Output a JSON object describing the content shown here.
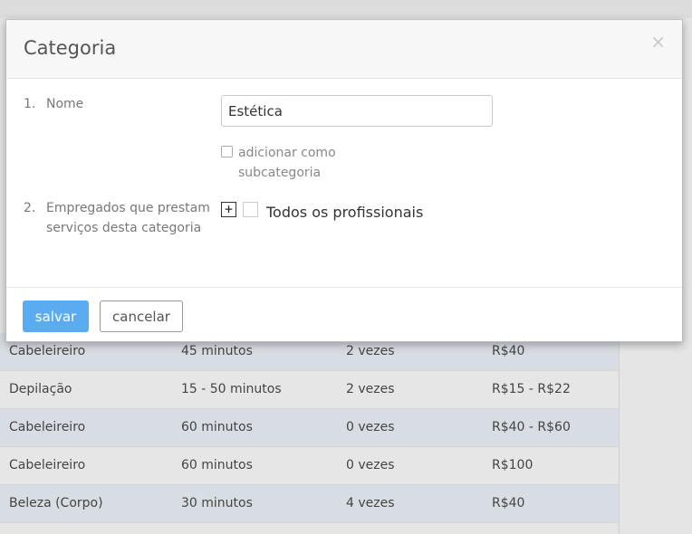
{
  "modal": {
    "title": "Categoria",
    "close_glyph": "×",
    "fields": {
      "name": {
        "number": "1.",
        "label": "Nome",
        "value": "Estética"
      },
      "subcategory": {
        "label": "adicionar como subcategoria",
        "checked": false
      },
      "employees": {
        "number": "2.",
        "label": "Empregados que prestam serviços desta categoria",
        "expand_glyph": "+",
        "all_label": "Todos os profissionais",
        "checked": false
      }
    },
    "buttons": {
      "save": "salvar",
      "cancel": "cancelar"
    }
  },
  "background_table": {
    "rows": [
      {
        "category": "Cabeleireiro",
        "duration": "45 minutos",
        "times": "2 vezes",
        "price": "R$40"
      },
      {
        "category": "Depilação",
        "duration": "15 - 50 minutos",
        "times": "2 vezes",
        "price": "R$15 - R$22"
      },
      {
        "category": "Cabeleireiro",
        "duration": "60 minutos",
        "times": "0 vezes",
        "price": "R$40 - R$60"
      },
      {
        "category": "Cabeleireiro",
        "duration": "60 minutos",
        "times": "0 vezes",
        "price": "R$100"
      },
      {
        "category": "Beleza (Corpo)",
        "duration": "30 minutos",
        "times": "4 vezes",
        "price": "R$40"
      }
    ]
  },
  "colors": {
    "accent": "#5aabf0",
    "row_alt": "#d8dde3"
  }
}
